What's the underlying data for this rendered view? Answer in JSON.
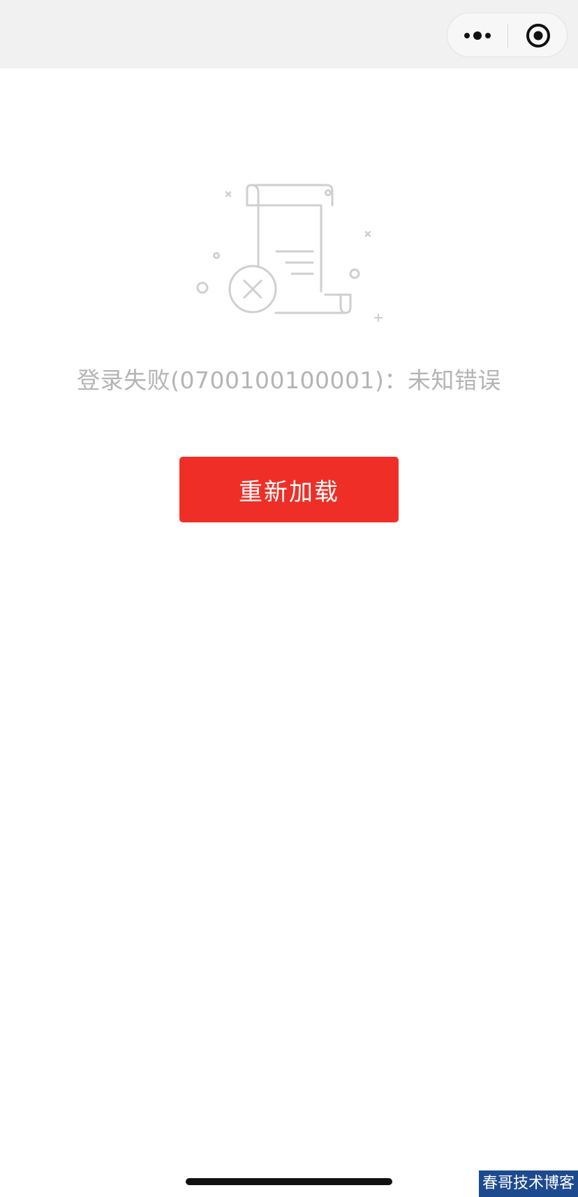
{
  "capsule": {
    "more_icon": "more-dots-icon",
    "close_icon": "target-circle-icon"
  },
  "illustration": {
    "icon": "document-error-icon",
    "stroke_color": "#cfcfcf"
  },
  "error": {
    "message": "登录失败(0700100100001)：未知错误",
    "color": "#b4b4b4"
  },
  "reload_button": {
    "label": "重新加载",
    "color": "#ef2f27"
  },
  "watermark": {
    "text": "春哥技术博客"
  }
}
